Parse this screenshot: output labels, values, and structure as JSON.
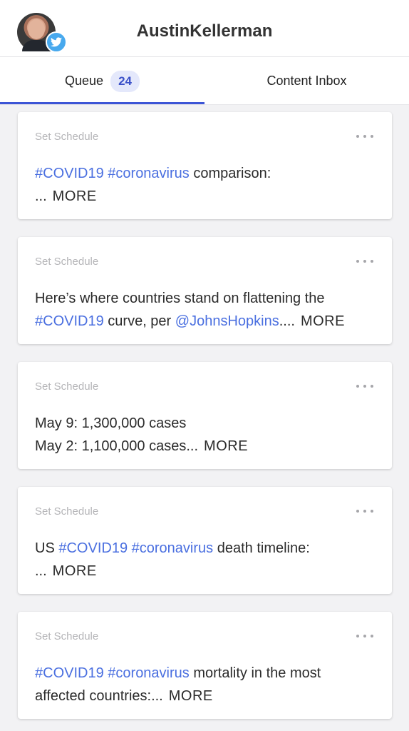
{
  "header": {
    "username": "AustinKellerman",
    "avatar_icon": "user-avatar",
    "badge_icon": "twitter-icon",
    "badge_color": "#48a9ee"
  },
  "tabs": {
    "queue": {
      "label": "Queue",
      "count": "24"
    },
    "inbox": {
      "label": "Content Inbox"
    },
    "active_color": "#3c55d6"
  },
  "posts": [
    {
      "schedule": "Set Schedule",
      "tag1": "#COVID19",
      "tag2": "#coronavirus",
      "text1": "comparison:",
      "ellipsis": "...",
      "more": "MORE"
    },
    {
      "schedule": "Set Schedule",
      "text1": "Here’s where countries stand on flattening the",
      "tag1": "#COVID19",
      "text2": "curve, per",
      "mention": "@JohnsHopkins",
      "ellipsis": "....",
      "more": "MORE"
    },
    {
      "schedule": "Set Schedule",
      "line1": "May 9: 1,300,000 cases",
      "line2": "May 2: 1,100,000 cases...",
      "more": "MORE"
    },
    {
      "schedule": "Set Schedule",
      "text0": "US",
      "tag1": "#COVID19",
      "tag2": "#coronavirus",
      "text1": "death timeline:",
      "ellipsis": "...",
      "more": "MORE"
    },
    {
      "schedule": "Set Schedule",
      "tag1": "#COVID19",
      "tag2": "#coronavirus",
      "text1": "mortality in the most",
      "text2": "affected countries:...",
      "more": "MORE"
    }
  ]
}
